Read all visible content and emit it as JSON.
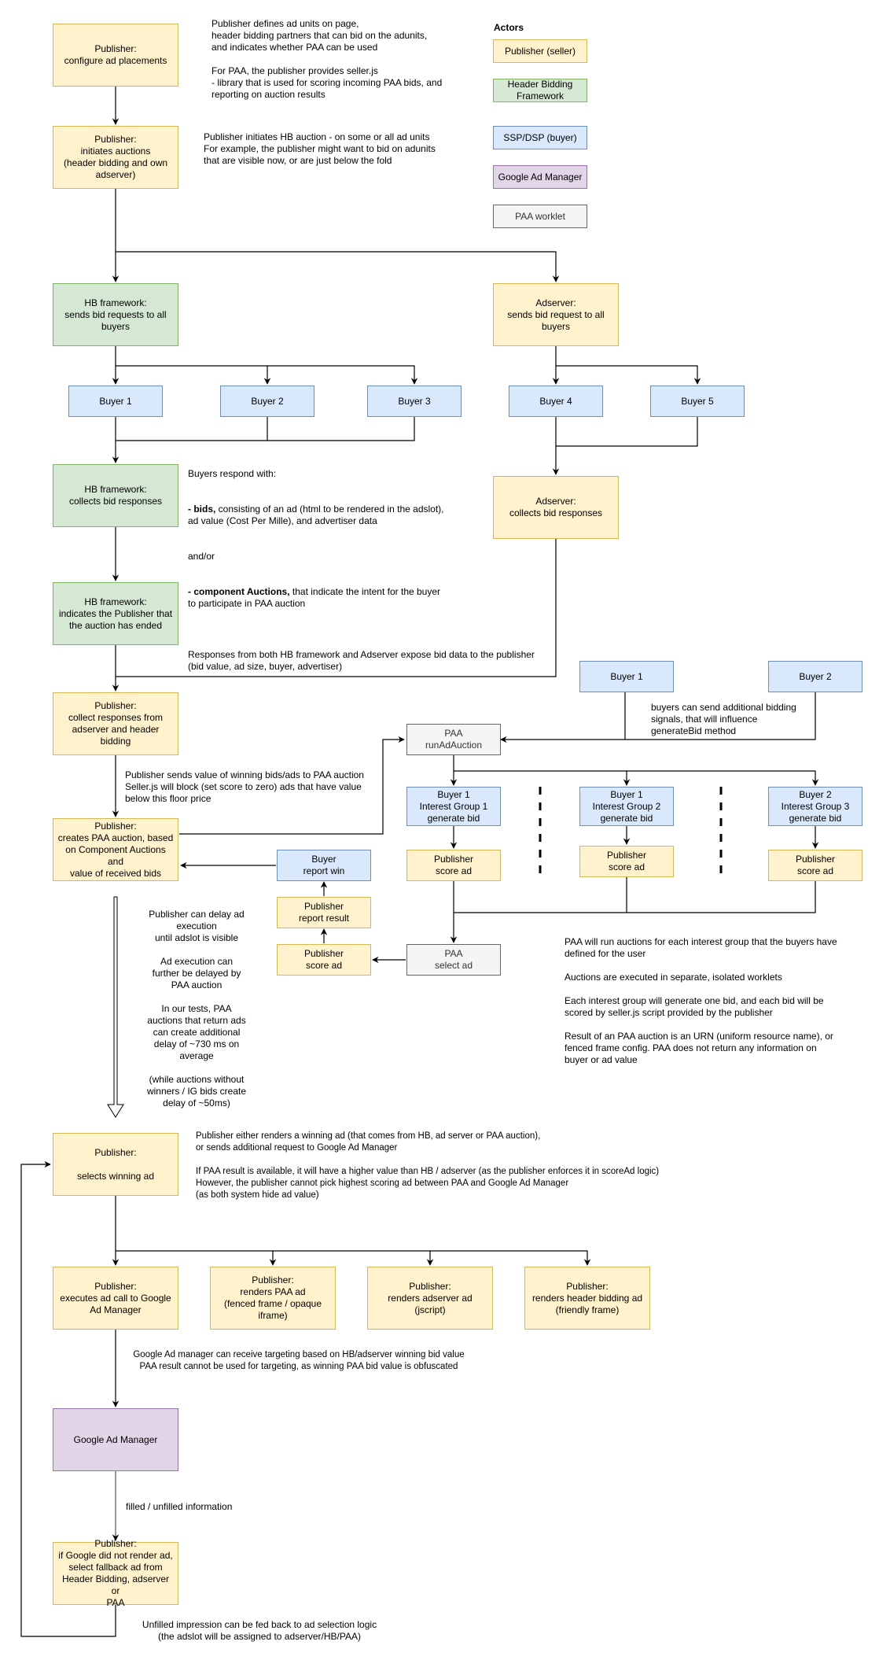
{
  "legend": {
    "title": "Actors",
    "items": [
      {
        "label": "Publisher (seller)",
        "kind": "publisher",
        "fill": "#fff2cc",
        "stroke": "#d6b656"
      },
      {
        "label": "Header Bidding\nFramework",
        "kind": "hb",
        "fill": "#d5e8d4",
        "stroke": "#82b366"
      },
      {
        "label": "SSP/DSP (buyer)",
        "kind": "buyer",
        "fill": "#dae8fc",
        "stroke": "#6c8ebf"
      },
      {
        "label": "Google Ad Manager",
        "kind": "gam",
        "fill": "#e1d5e7",
        "stroke": "#9673a6"
      },
      {
        "label": "PAA worklet",
        "kind": "paa",
        "fill": "#f5f5f5",
        "stroke": "#666666"
      }
    ]
  },
  "nodes": {
    "configure": "Publisher:\nconfigure ad placements",
    "initiates": "Publisher:\ninitiates auctions\n(header bidding and own\nadserver)",
    "hb_sends": "HB framework:\nsends bid requests to all\nbuyers",
    "adserver_sends": "Adserver:\nsends bid request to all\nbuyers",
    "buyer1": "Buyer 1",
    "buyer2": "Buyer 2",
    "buyer3": "Buyer 3",
    "buyer4": "Buyer 4",
    "buyer5": "Buyer 5",
    "hb_collects": "HB framework:\ncollects bid responses",
    "adserver_collects": "Adserver:\ncollects bid responses",
    "hb_indicates": "HB framework:\nindicates the Publisher that\nthe auction has ended",
    "pub_collect": "Publisher:\ncollect responses from\nadserver and header bidding",
    "pub_creates_paa": "Publisher:\ncreates PAA auction, based\non Component Auctions and\nvalue of received bids",
    "paa_buyer1": "Buyer 1",
    "paa_buyer2": "Buyer 2",
    "paa_run": "PAA\nrunAdAuction",
    "ig1": "Buyer 1\nInterest Group 1\ngenerate bid",
    "ig2": "Buyer 1\nInterest Group 2\ngenerate bid",
    "ig3": "Buyer 2\nInterest Group 3\ngenerate bid",
    "score1": "Publisher\nscore ad",
    "score2": "Publisher\nscore ad",
    "score3": "Publisher\nscore ad",
    "paa_select": "PAA\nselect ad",
    "pub_score_final": "Publisher\nscore ad",
    "pub_report_result": "Publisher\nreport result",
    "buyer_report_win": "Buyer\nreport win",
    "pub_selects": "Publisher:\n\nselects winning ad",
    "exec_gam": "Publisher:\nexecutes ad call to Google\nAd Manager",
    "render_paa": "Publisher:\nrenders PAA ad\n(fenced frame / opaque\niframe)",
    "render_adserver": "Publisher:\nrenders adserver ad\n(jscript)",
    "render_hb": "Publisher:\nrenders header bidding ad\n(friendly frame)",
    "gam": "Google Ad Manager",
    "fallback": "Publisher:\nif Google did not render ad,\nselect fallback ad from\nHeader Bidding, adserver or\nPAA"
  },
  "notes": {
    "configure": "Publisher defines ad units on page,\nheader bidding partners that can bid on the adunits,\nand indicates whether PAA can be used\n\nFor PAA, the publisher provides seller.js\n- library that is used for scoring incoming PAA bids, and\nreporting on auction results",
    "initiates": "Publisher initiates HB auction - on some or all ad units\nFor example, the publisher might want to bid on adunits\nthat are visible now, or are just below the fold",
    "buyers_respond_intro": "Buyers respond with:",
    "bids_bold": "- bids,",
    "bids_rest": " consisting of an ad (html to be rendered in the adslot),\n  ad value (Cost Per Mille), and advertiser data",
    "and_or": "and/or",
    "component_bold": "- component Auctions,",
    "component_rest": " that indicate the intent for the buyer\nto participate in PAA auction",
    "responses_both": "Responses from both HB framework and Adserver expose bid data to the publisher\n(bid value, ad size, buyer, advertiser)",
    "winning_value": "Publisher sends value of winning bids/ads to PAA auction\nSeller.js will block (set score to zero) ads that have value\nbelow this floor price",
    "bidding_signals": "buyers can send additional bidding\nsignals, that will influence\ngenerateBid method",
    "delay": "Publisher can delay ad\nexecution\nuntil adslot is visible\n\nAd execution can\nfurther be delayed by\nPAA auction\n\nIn our tests, PAA\nauctions that return ads\ncan create additional\ndelay of ~730 ms on\naverage\n\n(while auctions without\nwinners / IG bids create\ndelay of ~50ms)",
    "paa_explain": "PAA will run auctions for each interest group that the buyers have\ndefined for the user\n\nAuctions are executed in separate, isolated worklets\n\nEach interest group will generate one bid, and each bid will be\nscored  by seller.js script provided by the publisher\n\nResult of an PAA auction is an URN (uniform resource name), or\nfenced frame config. PAA does not return any information on\nbuyer or ad value",
    "selects": "Publisher either renders a winning ad (that comes from HB, ad server or PAA auction),\nor sends additional request to Google Ad Manager\n\nIf PAA result is available, it will have a higher value than HB / adserver (as the publisher enforces it in scoreAd logic)\nHowever, the publisher cannot pick highest scoring ad between PAA and Google Ad Manager\n(as both system hide ad value)",
    "targeting": "Google Ad manager can receive targeting based on HB/adserver winning bid value\nPAA result cannot be used for targeting, as winning PAA bid value is obfuscated",
    "filled": "filled / unfilled information",
    "unfilled": "Unfilled impression can be fed back to ad selection logic\n(the adslot will be assigned to adserver/HB/PAA)"
  }
}
